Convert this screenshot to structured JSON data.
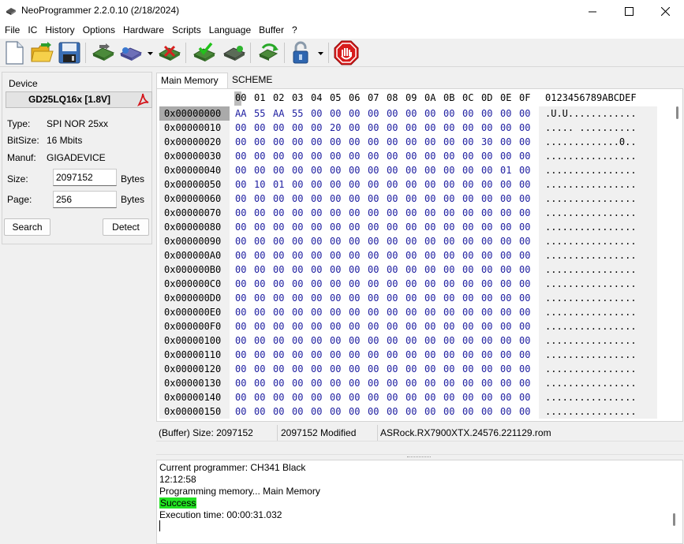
{
  "window": {
    "title": "NeoProgrammer 2.2.0.10 (2/18/2024)"
  },
  "menu": [
    "File",
    "IC",
    "History",
    "Options",
    "Hardware",
    "Scripts",
    "Language",
    "Buffer",
    "?"
  ],
  "toolbar": {
    "icons": [
      "new-file-icon",
      "open-folder-icon",
      "save-disk-icon",
      "read-chip-icon",
      "write-chip-icon",
      "erase-chip-icon",
      "verify-chip-icon",
      "blank-check-icon",
      "auto-program-icon",
      "lock-icon",
      "stop-icon"
    ]
  },
  "device": {
    "group_label": "Device",
    "name": "GD25LQ16x [1.8V]",
    "type_label": "Type:",
    "type_value": "SPI NOR  25xx",
    "bitsize_label": "BitSize:",
    "bitsize_value": "16 Mbits",
    "manuf_label": "Manuf:",
    "manuf_value": "GIGADEVICE",
    "size_label": "Size:",
    "size_value": "2097152",
    "size_unit": "Bytes",
    "page_label": "Page:",
    "page_value": "256",
    "page_unit": "Bytes",
    "search_label": "Search",
    "detect_label": "Detect"
  },
  "tabs": [
    "Main Memory",
    "SCHEME"
  ],
  "hex": {
    "columns": [
      "00",
      "01",
      "02",
      "03",
      "04",
      "05",
      "06",
      "07",
      "08",
      "09",
      "0A",
      "0B",
      "0C",
      "0D",
      "0E",
      "0F"
    ],
    "ascii_header": "0123456789ABCDEF",
    "rows": [
      {
        "addr": "0x00000000",
        "bytes": [
          "AA",
          "55",
          "AA",
          "55",
          "00",
          "00",
          "00",
          "00",
          "00",
          "00",
          "00",
          "00",
          "00",
          "00",
          "00",
          "00"
        ],
        "ascii": ".U.U............"
      },
      {
        "addr": "0x00000010",
        "bytes": [
          "00",
          "00",
          "00",
          "00",
          "00",
          "20",
          "00",
          "00",
          "00",
          "00",
          "00",
          "00",
          "00",
          "00",
          "00",
          "00"
        ],
        "ascii": "..... .........."
      },
      {
        "addr": "0x00000020",
        "bytes": [
          "00",
          "00",
          "00",
          "00",
          "00",
          "00",
          "00",
          "00",
          "00",
          "00",
          "00",
          "00",
          "00",
          "30",
          "00",
          "00"
        ],
        "ascii": ".............0.."
      },
      {
        "addr": "0x00000030",
        "bytes": [
          "00",
          "00",
          "00",
          "00",
          "00",
          "00",
          "00",
          "00",
          "00",
          "00",
          "00",
          "00",
          "00",
          "00",
          "00",
          "00"
        ],
        "ascii": "................"
      },
      {
        "addr": "0x00000040",
        "bytes": [
          "00",
          "00",
          "00",
          "00",
          "00",
          "00",
          "00",
          "00",
          "00",
          "00",
          "00",
          "00",
          "00",
          "00",
          "01",
          "00"
        ],
        "ascii": "................"
      },
      {
        "addr": "0x00000050",
        "bytes": [
          "00",
          "10",
          "01",
          "00",
          "00",
          "00",
          "00",
          "00",
          "00",
          "00",
          "00",
          "00",
          "00",
          "00",
          "00",
          "00"
        ],
        "ascii": "................"
      },
      {
        "addr": "0x00000060",
        "bytes": [
          "00",
          "00",
          "00",
          "00",
          "00",
          "00",
          "00",
          "00",
          "00",
          "00",
          "00",
          "00",
          "00",
          "00",
          "00",
          "00"
        ],
        "ascii": "................"
      },
      {
        "addr": "0x00000070",
        "bytes": [
          "00",
          "00",
          "00",
          "00",
          "00",
          "00",
          "00",
          "00",
          "00",
          "00",
          "00",
          "00",
          "00",
          "00",
          "00",
          "00"
        ],
        "ascii": "................"
      },
      {
        "addr": "0x00000080",
        "bytes": [
          "00",
          "00",
          "00",
          "00",
          "00",
          "00",
          "00",
          "00",
          "00",
          "00",
          "00",
          "00",
          "00",
          "00",
          "00",
          "00"
        ],
        "ascii": "................"
      },
      {
        "addr": "0x00000090",
        "bytes": [
          "00",
          "00",
          "00",
          "00",
          "00",
          "00",
          "00",
          "00",
          "00",
          "00",
          "00",
          "00",
          "00",
          "00",
          "00",
          "00"
        ],
        "ascii": "................"
      },
      {
        "addr": "0x000000A0",
        "bytes": [
          "00",
          "00",
          "00",
          "00",
          "00",
          "00",
          "00",
          "00",
          "00",
          "00",
          "00",
          "00",
          "00",
          "00",
          "00",
          "00"
        ],
        "ascii": "................"
      },
      {
        "addr": "0x000000B0",
        "bytes": [
          "00",
          "00",
          "00",
          "00",
          "00",
          "00",
          "00",
          "00",
          "00",
          "00",
          "00",
          "00",
          "00",
          "00",
          "00",
          "00"
        ],
        "ascii": "................"
      },
      {
        "addr": "0x000000C0",
        "bytes": [
          "00",
          "00",
          "00",
          "00",
          "00",
          "00",
          "00",
          "00",
          "00",
          "00",
          "00",
          "00",
          "00",
          "00",
          "00",
          "00"
        ],
        "ascii": "................"
      },
      {
        "addr": "0x000000D0",
        "bytes": [
          "00",
          "00",
          "00",
          "00",
          "00",
          "00",
          "00",
          "00",
          "00",
          "00",
          "00",
          "00",
          "00",
          "00",
          "00",
          "00"
        ],
        "ascii": "................"
      },
      {
        "addr": "0x000000E0",
        "bytes": [
          "00",
          "00",
          "00",
          "00",
          "00",
          "00",
          "00",
          "00",
          "00",
          "00",
          "00",
          "00",
          "00",
          "00",
          "00",
          "00"
        ],
        "ascii": "................"
      },
      {
        "addr": "0x000000F0",
        "bytes": [
          "00",
          "00",
          "00",
          "00",
          "00",
          "00",
          "00",
          "00",
          "00",
          "00",
          "00",
          "00",
          "00",
          "00",
          "00",
          "00"
        ],
        "ascii": "................"
      },
      {
        "addr": "0x00000100",
        "bytes": [
          "00",
          "00",
          "00",
          "00",
          "00",
          "00",
          "00",
          "00",
          "00",
          "00",
          "00",
          "00",
          "00",
          "00",
          "00",
          "00"
        ],
        "ascii": "................"
      },
      {
        "addr": "0x00000110",
        "bytes": [
          "00",
          "00",
          "00",
          "00",
          "00",
          "00",
          "00",
          "00",
          "00",
          "00",
          "00",
          "00",
          "00",
          "00",
          "00",
          "00"
        ],
        "ascii": "................"
      },
      {
        "addr": "0x00000120",
        "bytes": [
          "00",
          "00",
          "00",
          "00",
          "00",
          "00",
          "00",
          "00",
          "00",
          "00",
          "00",
          "00",
          "00",
          "00",
          "00",
          "00"
        ],
        "ascii": "................"
      },
      {
        "addr": "0x00000130",
        "bytes": [
          "00",
          "00",
          "00",
          "00",
          "00",
          "00",
          "00",
          "00",
          "00",
          "00",
          "00",
          "00",
          "00",
          "00",
          "00",
          "00"
        ],
        "ascii": "................"
      },
      {
        "addr": "0x00000140",
        "bytes": [
          "00",
          "00",
          "00",
          "00",
          "00",
          "00",
          "00",
          "00",
          "00",
          "00",
          "00",
          "00",
          "00",
          "00",
          "00",
          "00"
        ],
        "ascii": "................"
      },
      {
        "addr": "0x00000150",
        "bytes": [
          "00",
          "00",
          "00",
          "00",
          "00",
          "00",
          "00",
          "00",
          "00",
          "00",
          "00",
          "00",
          "00",
          "00",
          "00",
          "00"
        ],
        "ascii": "................"
      }
    ]
  },
  "status": {
    "buffer_size": "(Buffer) Size: 2097152",
    "modified": "2097152 Modified",
    "file": "ASRock.RX7900XTX.24576.221129.rom"
  },
  "log": {
    "lines": [
      "Current programmer: CH341 Black",
      "12:12:58",
      "Programming memory... Main Memory"
    ],
    "success": "Success",
    "exec": "Execution time: 00:00:31.032"
  }
}
